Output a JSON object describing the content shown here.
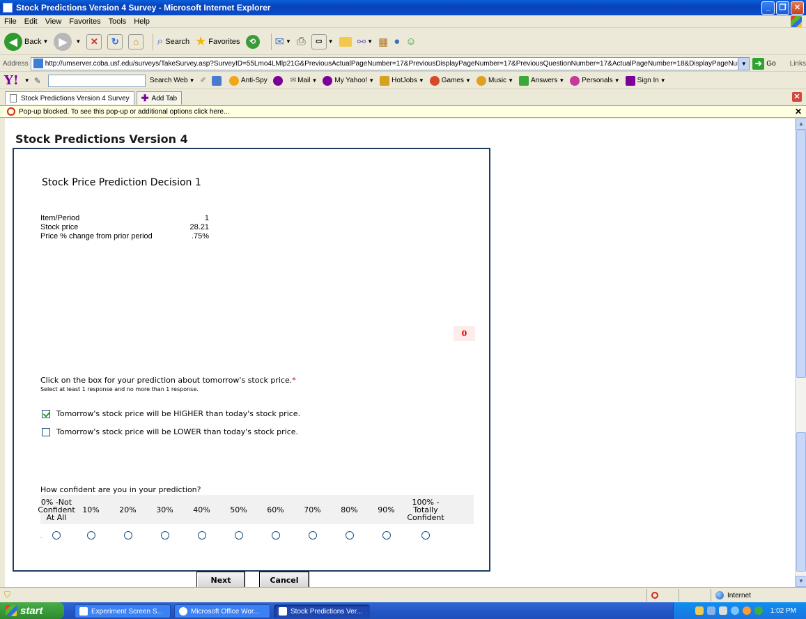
{
  "window": {
    "title": "Stock Predictions Version 4 Survey - Microsoft Internet Explorer"
  },
  "menu": [
    "File",
    "Edit",
    "View",
    "Favorites",
    "Tools",
    "Help"
  ],
  "toolbar": {
    "back": "Back",
    "search": "Search",
    "favorites": "Favorites"
  },
  "address": {
    "label": "Address",
    "url": "http://umserver.coba.usf.edu/surveys/TakeSurvey.asp?SurveyID=55Lmo4LMlp21G&PreviousActualPageNumber=17&PreviousDisplayPageNumber=17&PreviousQuestionNumber=17&ActualPageNumber=18&DisplayPageNumb",
    "go": "Go",
    "links": "Links"
  },
  "yahoo": {
    "logo": "Y!",
    "search_web": "Search Web",
    "antispy": "Anti-Spy",
    "mail": "Mail",
    "my_yahoo": "My Yahoo!",
    "hotjobs": "HotJobs",
    "games": "Games",
    "music": "Music",
    "answers": "Answers",
    "personals": "Personals",
    "sign_in": "Sign In"
  },
  "tabs": {
    "active": "Stock Predictions Version 4 Survey",
    "add": "Add Tab"
  },
  "popup": {
    "message": "Pop-up blocked. To see this pop-up or additional options click here..."
  },
  "page": {
    "title": "Stock Predictions Version 4",
    "question_title": "Stock Price Prediction Decision 1",
    "info": [
      {
        "label": "Item/Period",
        "value": "1"
      },
      {
        "label": "Stock price",
        "value": "28.21"
      },
      {
        "label": "Price % change from prior period",
        "value": ".75%"
      }
    ],
    "badge": "0",
    "prompt": "Click on the box for your prediction about tomorrow's stock price.",
    "required_mark": "*",
    "subprompt": "Select at least 1 response and no more than 1 response.",
    "option_higher": "Tomorrow's stock price will be HIGHER than today's stock price.",
    "option_lower": "Tomorrow's stock price will be LOWER than today's stock price.",
    "confidence_question": "How confident are you in your prediction?",
    "confidence_scale": [
      "0% -Not Confident At All",
      "10%",
      "20%",
      "30%",
      "40%",
      "50%",
      "60%",
      "70%",
      "80%",
      "90%",
      "100% - Totally Confident"
    ],
    "radio_prefix": ".",
    "next": "Next",
    "cancel": "Cancel"
  },
  "status": {
    "zone": "Internet"
  },
  "taskbar": {
    "start": "start",
    "tasks": [
      "Experiment Screen S...",
      "Microsoft Office Wor...",
      "Stock Predictions Ver..."
    ],
    "time": "1:02 PM"
  }
}
